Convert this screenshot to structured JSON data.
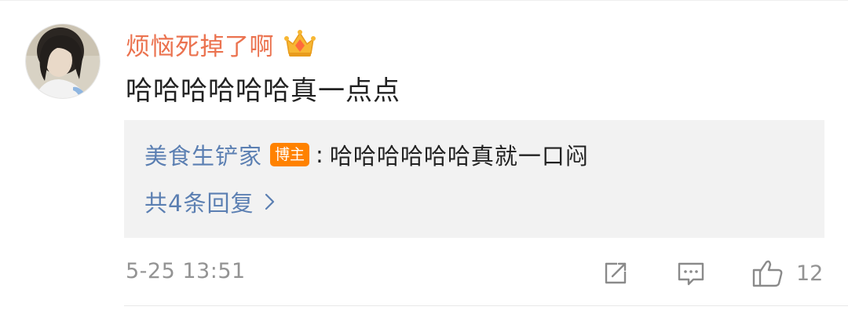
{
  "comment": {
    "username": "烦恼死掉了啊",
    "text": "哈哈哈哈哈哈真一点点",
    "timestamp": "5-25 13:51",
    "like_count": "12"
  },
  "reply": {
    "author": "美食生铲家",
    "badge": "博主",
    "separator": ":",
    "text": "哈哈哈哈哈哈真就一口闷",
    "count_label": "共4条回复"
  },
  "colors": {
    "username": "#eb7350",
    "link": "#5b7fb2",
    "badge_bg": "#ff8200",
    "meta": "#939393",
    "reply_bg": "#f2f2f2"
  },
  "icons": {
    "avatar": "avatar-photo",
    "crown": "crown-icon",
    "chevron": "chevron-right-icon",
    "share": "share-icon",
    "comment": "comment-icon",
    "like": "thumbs-up-icon"
  }
}
